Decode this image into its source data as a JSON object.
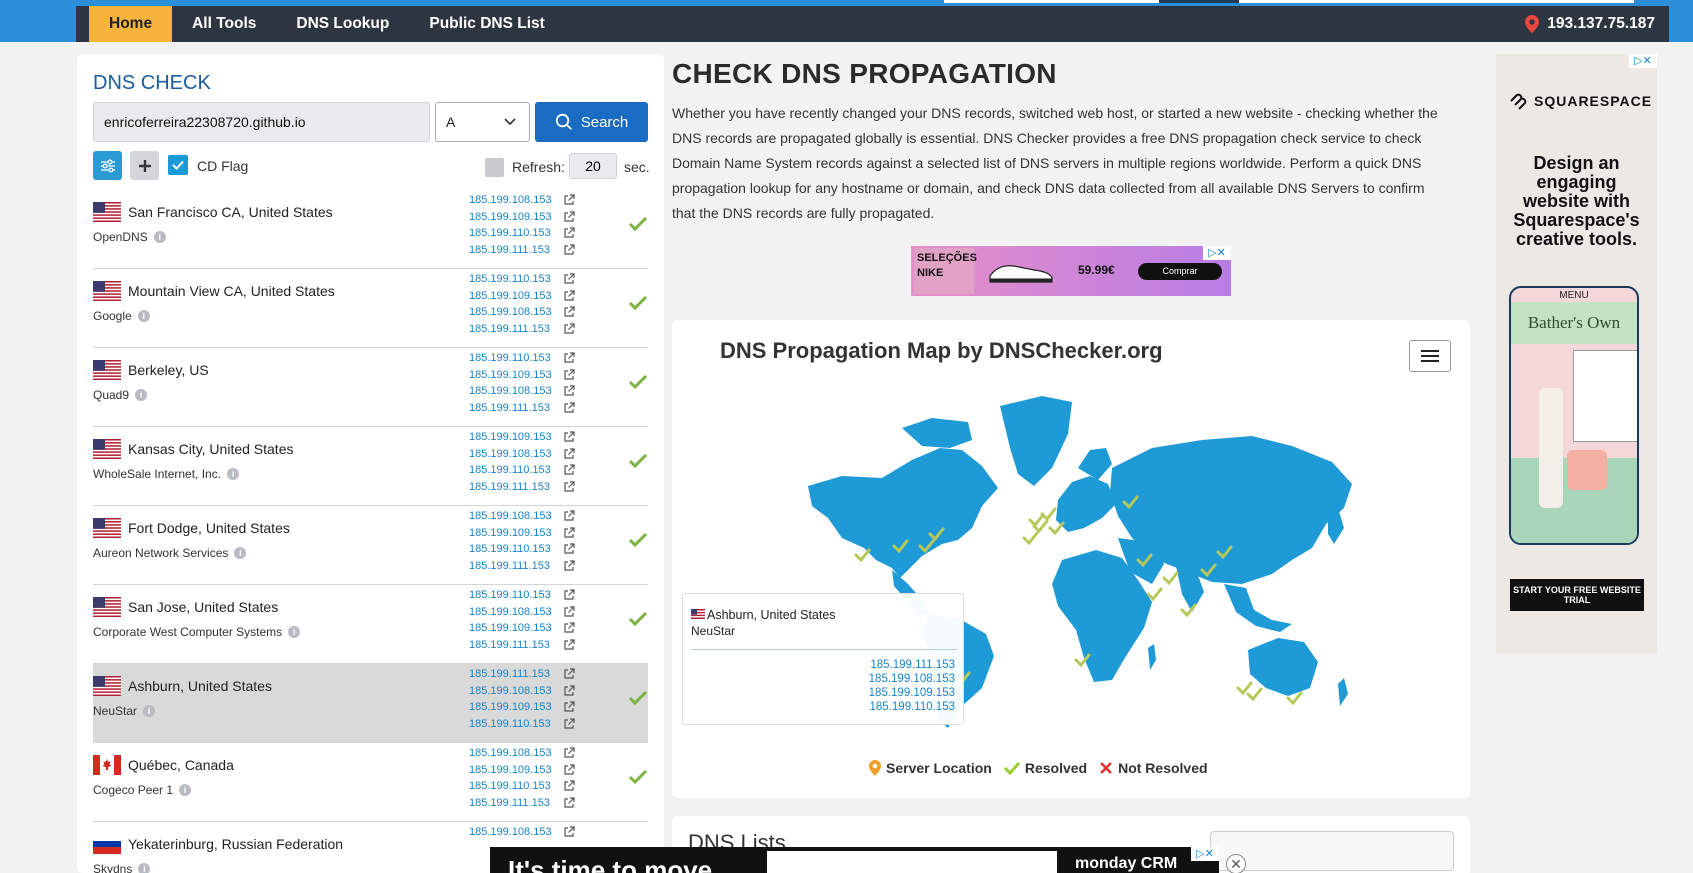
{
  "nav": {
    "items": [
      "Home",
      "All Tools",
      "DNS Lookup",
      "Public DNS List"
    ],
    "ip": "193.137.75.187"
  },
  "check": {
    "title": "DNS CHECK",
    "domain": "enricoferreira22308720.github.io",
    "record_type": "A",
    "search_label": "Search",
    "cd_flag_label": "CD Flag",
    "refresh_label": "Refresh:",
    "refresh_value": "20",
    "refresh_unit": "sec."
  },
  "results": [
    {
      "location": "San Francisco CA, United States",
      "provider": "OpenDNS",
      "flag": "us",
      "ips": [
        "185.199.108.153",
        "185.199.109.153",
        "185.199.110.153",
        "185.199.111.153"
      ]
    },
    {
      "location": "Mountain View CA, United States",
      "provider": "Google",
      "flag": "us",
      "ips": [
        "185.199.110.153",
        "185.199.109.153",
        "185.199.108.153",
        "185.199.111.153"
      ]
    },
    {
      "location": "Berkeley, US",
      "provider": "Quad9",
      "flag": "us",
      "ips": [
        "185.199.110.153",
        "185.199.109.153",
        "185.199.108.153",
        "185.199.111.153"
      ]
    },
    {
      "location": "Kansas City, United States",
      "provider": "WholeSale Internet, Inc.",
      "flag": "us",
      "ips": [
        "185.199.109.153",
        "185.199.108.153",
        "185.199.110.153",
        "185.199.111.153"
      ]
    },
    {
      "location": "Fort Dodge, United States",
      "provider": "Aureon Network Services",
      "flag": "us",
      "ips": [
        "185.199.108.153",
        "185.199.109.153",
        "185.199.110.153",
        "185.199.111.153"
      ]
    },
    {
      "location": "San Jose, United States",
      "provider": "Corporate West Computer Systems",
      "flag": "us",
      "ips": [
        "185.199.110.153",
        "185.199.108.153",
        "185.199.109.153",
        "185.199.111.153"
      ]
    },
    {
      "location": "Ashburn, United States",
      "provider": "NeuStar",
      "flag": "us",
      "highlight": true,
      "ips": [
        "185.199.111.153",
        "185.199.108.153",
        "185.199.109.153",
        "185.199.110.153"
      ]
    },
    {
      "location": "Québec, Canada",
      "provider": "Cogeco Peer 1",
      "flag": "ca",
      "ips": [
        "185.199.108.153",
        "185.199.109.153",
        "185.199.110.153",
        "185.199.111.153"
      ]
    },
    {
      "location": "Yekaterinburg, Russian Federation",
      "provider": "Skydns",
      "flag": "ru",
      "ips": [
        "185.199.108.153"
      ]
    }
  ],
  "main": {
    "title": "CHECK DNS PROPAGATION",
    "description": "Whether you have recently changed your DNS records, switched web host, or started a new website - checking whether the DNS records are propagated globally is essential. DNS Checker provides a free DNS propagation check service to check Domain Name System records against a selected list of DNS servers in multiple regions worldwide. Perform a quick DNS propagation lookup for any hostname or domain, and check DNS data collected from all available DNS Servers to confirm that the DNS records are fully propagated."
  },
  "ad_banner": {
    "brand": "SELEÇÕES NIKE",
    "price": "59.99€",
    "cta": "Comprar"
  },
  "map": {
    "title": "DNS Propagation Map by DNSChecker.org",
    "tooltip": {
      "location": "Ashburn, United States",
      "provider": "NeuStar",
      "ips": [
        "185.199.111.153",
        "185.199.108.153",
        "185.199.109.153",
        "185.199.110.153"
      ]
    },
    "legend": {
      "server": "Server Location",
      "resolved": "Resolved",
      "not_resolved": "Not Resolved"
    },
    "colors": {
      "land": "#1e9ad6",
      "resolved": "#9acd32",
      "not_resolved": "#e63333"
    }
  },
  "lists": {
    "title": "DNS Lists"
  },
  "side_ad": {
    "brand": "SQUARESPACE",
    "headline": "Design an engaging website with Squarespace's creative tools.",
    "phone_menu": "MENU",
    "phone_title": "Bather's Own",
    "cta": "START YOUR FREE WEBSITE TRIAL"
  },
  "bottom_ad": {
    "text": "It's time to move",
    "brand": "monday CRM"
  }
}
